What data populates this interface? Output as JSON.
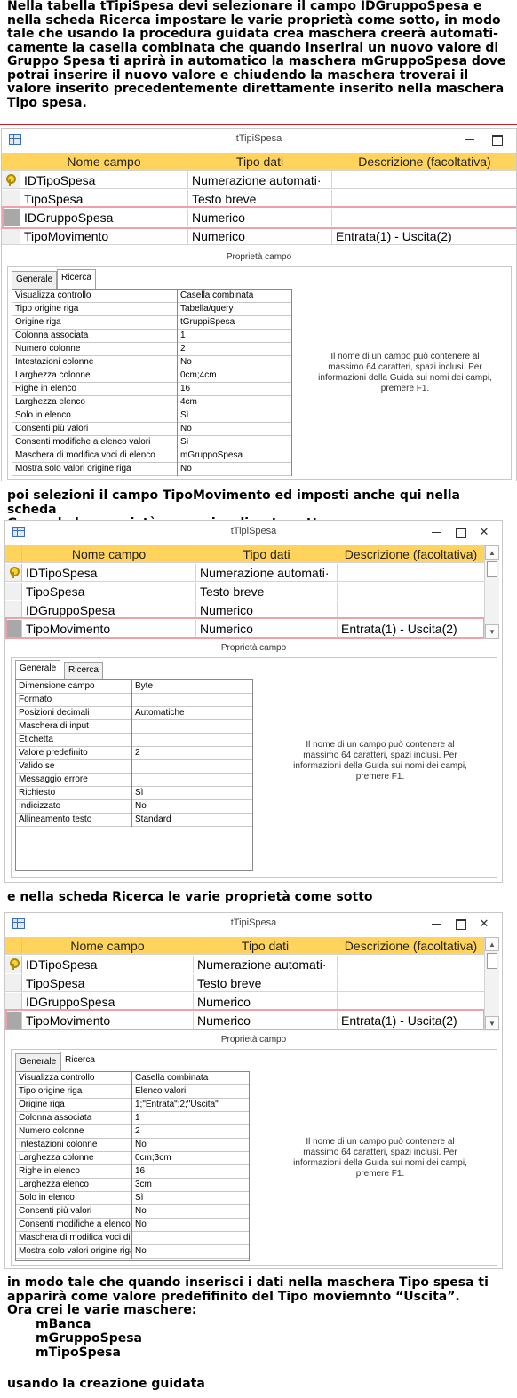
{
  "para_intro": "Nella tabella tTipiSpesa devi selezionare il campo IDGruppoSpesa e\nnella scheda Ricerca impostare le varie proprietà come sotto, in modo\ntale che usando la procedura guidata crea maschera creerà automati-\ncamente la casella combinata che quando inserirai un nuovo valore di\nGruppo Spesa ti aprirà in automatico la maschera mGruppoSpesa dove\npotrai inserire il nuovo valore e chiudendo la maschera troverai il\nvalore inserito precedentemente direttamente inserito nella maschera\nTipo spesa.",
  "para_second": "poi selezioni il campo TipoMovimento ed imposti anche qui nella scheda\nGenerale le proprietà come visualizzato sotto",
  "para_third": "e nella scheda Ricerca le varie proprietà come sotto",
  "para_fourth": "in modo tale che quando inserisci i dati nella maschera Tipo spesa ti\napparirà come valore predefifinito del Tipo moviemnto “Uscita”.\nOra crei le varie maschere:",
  "forms_list": [
    "mBanca",
    "mGruppoSpesa",
    "mTipoSpesa"
  ],
  "para_last": "usando la creazione guidata",
  "window_title": "tTipiSpesa",
  "columns": {
    "field": "Nome campo",
    "type": "Tipo dati",
    "desc": "Descrizione (facoltativa)"
  },
  "table_rows": [
    {
      "name": "IDTipoSpesa",
      "type": "Numerazione automati·",
      "desc": "",
      "key": true
    },
    {
      "name": "TipoSpesa",
      "type": "Testo breve",
      "desc": ""
    },
    {
      "name": "IDGruppoSpesa",
      "type": "Numerico",
      "desc": ""
    },
    {
      "name": "TipoMovimento",
      "type": "Numerico",
      "desc": "Entrata(1) - Uscita(2)"
    }
  ],
  "props_label": "Proprietà campo",
  "tabs": {
    "general": "Generale",
    "lookup": "Ricerca"
  },
  "help_text": "Il nome di un campo può contenere al\nmassimo 64 caratteri, spazi inclusi. Per\ninformazioni della Guida sui nomi dei campi,\npremere F1.",
  "window1_props": [
    [
      "Visualizza controllo",
      "Casella combinata"
    ],
    [
      "Tipo origine riga",
      "Tabella/query"
    ],
    [
      "Origine riga",
      "tGruppiSpesa"
    ],
    [
      "Colonna associata",
      "1"
    ],
    [
      "Numero colonne",
      "2"
    ],
    [
      "Intestazioni colonne",
      "No"
    ],
    [
      "Larghezza colonne",
      "0cm;4cm"
    ],
    [
      "Righe in elenco",
      "16"
    ],
    [
      "Larghezza elenco",
      "4cm"
    ],
    [
      "Solo in elenco",
      "Sì"
    ],
    [
      "Consenti più valori",
      "No"
    ],
    [
      "Consenti modifiche a elenco valori",
      "Sì"
    ],
    [
      "Maschera di modifica voci di elenco",
      "mGruppoSpesa"
    ],
    [
      "Mostra solo valori origine riga",
      "No"
    ]
  ],
  "window2_props": [
    [
      "Dimensione campo",
      "Byte"
    ],
    [
      "Formato",
      ""
    ],
    [
      "Posizioni decimali",
      "Automatiche"
    ],
    [
      "Maschera di input",
      ""
    ],
    [
      "Etichetta",
      ""
    ],
    [
      "Valore predefinito",
      "2"
    ],
    [
      "Valido se",
      ""
    ],
    [
      "Messaggio errore",
      ""
    ],
    [
      "Richiesto",
      "Sì"
    ],
    [
      "Indicizzato",
      "No"
    ],
    [
      "Allineamento testo",
      "Standard"
    ]
  ],
  "window3_props": [
    [
      "Visualizza controllo",
      "Casella combinata"
    ],
    [
      "Tipo origine riga",
      "Elenco valori"
    ],
    [
      "Origine riga",
      "1;\"Entrata\";2;\"Uscita\""
    ],
    [
      "Colonna associata",
      "1"
    ],
    [
      "Numero colonne",
      "2"
    ],
    [
      "Intestazioni colonne",
      "No"
    ],
    [
      "Larghezza colonne",
      "0cm;3cm"
    ],
    [
      "Righe in elenco",
      "16"
    ],
    [
      "Larghezza elenco",
      "3cm"
    ],
    [
      "Solo in elenco",
      "Sì"
    ],
    [
      "Consenti più valori",
      "No"
    ],
    [
      "Consenti modifiche a elenco valori",
      "No"
    ],
    [
      "Maschera di modifica voci di elenco",
      ""
    ],
    [
      "Mostra solo valori origine riga",
      "No"
    ]
  ],
  "colors": {
    "header_bg": "#ffd35c",
    "highlight": "#f0a0a8",
    "separator": "#c0202a"
  }
}
